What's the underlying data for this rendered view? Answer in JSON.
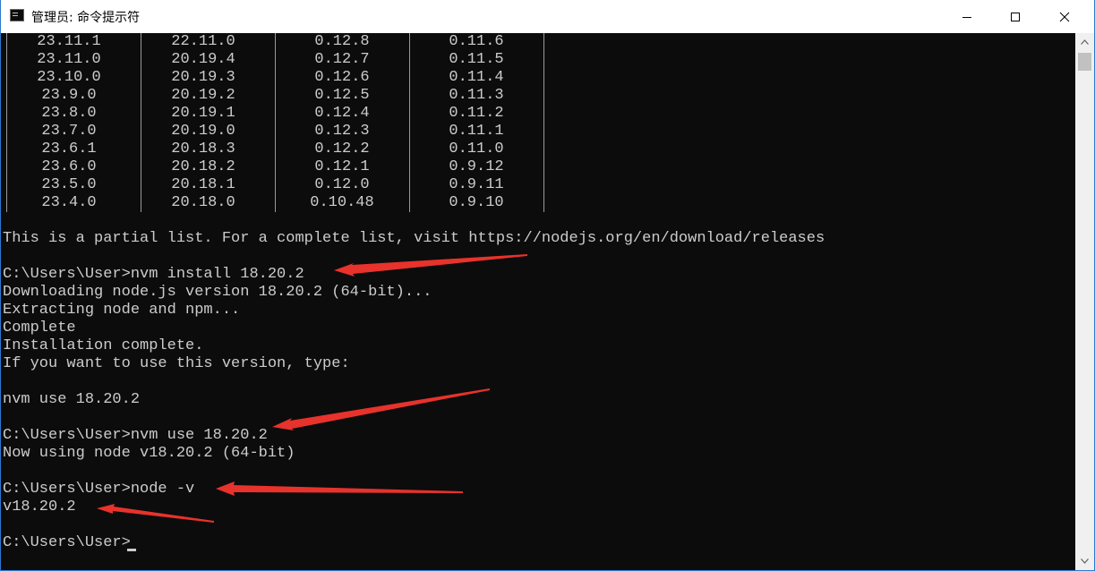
{
  "window": {
    "title": "管理员: 命令提示符"
  },
  "version_table": {
    "rows": [
      [
        "23.11.1",
        "22.11.0",
        "0.12.8",
        "0.11.6"
      ],
      [
        "23.11.0",
        "20.19.4",
        "0.12.7",
        "0.11.5"
      ],
      [
        "23.10.0",
        "20.19.3",
        "0.12.6",
        "0.11.4"
      ],
      [
        "23.9.0",
        "20.19.2",
        "0.12.5",
        "0.11.3"
      ],
      [
        "23.8.0",
        "20.19.1",
        "0.12.4",
        "0.11.2"
      ],
      [
        "23.7.0",
        "20.19.0",
        "0.12.3",
        "0.11.1"
      ],
      [
        "23.6.1",
        "20.18.3",
        "0.12.2",
        "0.11.0"
      ],
      [
        "23.6.0",
        "20.18.2",
        "0.12.1",
        "0.9.12"
      ],
      [
        "23.5.0",
        "20.18.1",
        "0.12.0",
        "0.9.11"
      ],
      [
        "23.4.0",
        "20.18.0",
        "0.10.48",
        "0.9.10"
      ]
    ]
  },
  "console": {
    "lines": [
      "This is a partial list. For a complete list, visit https://nodejs.org/en/download/releases",
      "",
      "C:\\Users\\User>nvm install 18.20.2",
      "Downloading node.js version 18.20.2 (64-bit)...",
      "Extracting node and npm...",
      "Complete",
      "Installation complete.",
      "If you want to use this version, type:",
      "",
      "nvm use 18.20.2",
      "",
      "C:\\Users\\User>nvm use 18.20.2",
      "Now using node v18.20.2 (64-bit)",
      "",
      "C:\\Users\\User>node -v",
      "v18.20.2",
      "",
      "C:\\Users\\User>"
    ]
  },
  "colors": {
    "background": "#0c0c0c",
    "text": "#cccccc",
    "annotation_arrow": "#e8322c",
    "titlebar": "#ffffff"
  },
  "icons": {
    "app": "cmd-icon",
    "minimize": "minimize-icon",
    "maximize": "maximize-icon",
    "close": "close-icon",
    "scroll_up": "arrow-up-icon",
    "scroll_down": "arrow-down-icon"
  }
}
